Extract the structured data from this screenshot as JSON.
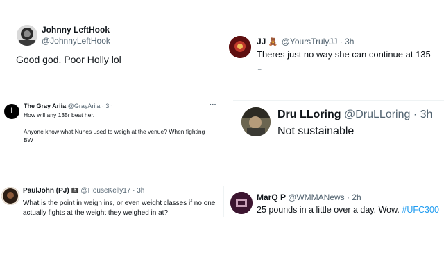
{
  "tweets": [
    {
      "name": "Johnny LeftHook",
      "handle": "@JohnnyLeftHook",
      "text": "Good god. Poor Holly lol"
    },
    {
      "name": "JJ",
      "badge_emoji": "🧸",
      "handle_time": "@YoursTrulyJJ · 3h",
      "text": "Theres just no way she can continue at 135"
    },
    {
      "name": "The Gray Ariia",
      "handle_time": "@GrayAriia · 3h",
      "more": "···",
      "text_line1": "How will any 135r beat her.",
      "text_line2": "Anyone know what Nunes used to weigh at the venue? When fighting",
      "text_line3": "BW",
      "avatar_letter": "I"
    },
    {
      "name": "Dru LLoring",
      "handle_time": "@DruLLoring · 3h",
      "text": "Not sustainable"
    },
    {
      "name": "PaulJohn (PJ)",
      "badge_emoji": "🏴‍☠️",
      "handle_time": "@HouseKelly17 · 3h",
      "text_line1": "What is the point in weigh ins, or even weight classes if no one",
      "text_line2": "actually fights at the weight they weighed in at?"
    },
    {
      "name": "MarQ P",
      "handle_time": "@WMMANews · 2h",
      "text_prefix": "25 pounds in a little over a day. Wow.",
      "hashtag": "#UFC300"
    }
  ]
}
